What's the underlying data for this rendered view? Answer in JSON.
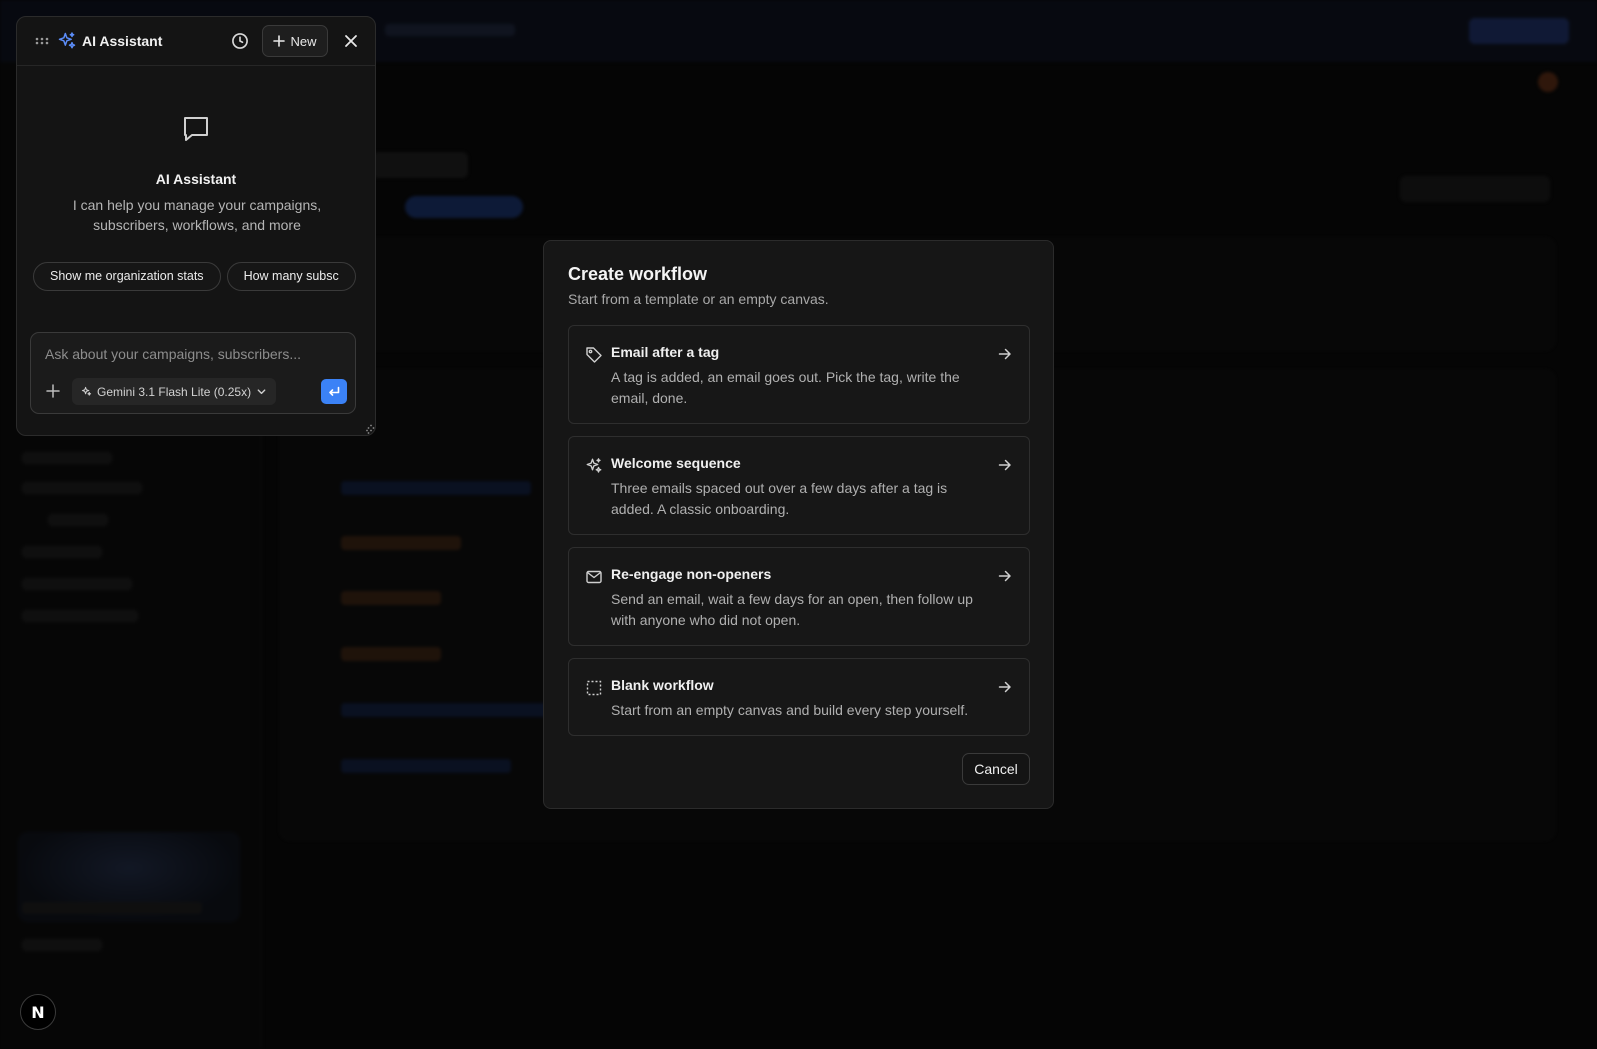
{
  "ai_assistant": {
    "title": "AI Assistant",
    "new_label": "New",
    "empty_title": "AI Assistant",
    "empty_description": "I can help you manage your campaigns, subscribers, workflows, and more",
    "suggestions": [
      "Show me organization stats",
      "How many subsc"
    ],
    "input_placeholder": "Ask about your campaigns, subscribers...",
    "model_label": "Gemini 3.1 Flash Lite (0.25x)",
    "icons": [
      "drag-handle-icon",
      "sparkles-icon",
      "history-clock-icon",
      "plus-icon",
      "close-icon",
      "chat-bubble-icon",
      "chevron-down-icon",
      "enter-icon",
      "resize-handle-icon"
    ]
  },
  "modal": {
    "title": "Create workflow",
    "subtitle": "Start from a template or an empty canvas.",
    "options": [
      {
        "icon": "tag-icon",
        "title": "Email after a tag",
        "description": "A tag is added, an email goes out. Pick the tag, write the email, done."
      },
      {
        "icon": "sparkles-icon",
        "title": "Welcome sequence",
        "description": "Three emails spaced out over a few days after a tag is added. A classic onboarding."
      },
      {
        "icon": "mail-icon",
        "title": "Re-engage non-openers",
        "description": "Send an email, wait a few days for an open, then follow up with anyone who did not open."
      },
      {
        "icon": "dashed-square-icon",
        "title": "Blank workflow",
        "description": "Start from an empty canvas and build every step yourself."
      }
    ],
    "cancel_label": "Cancel"
  },
  "dev_badge": {
    "letter": "N"
  },
  "colors": {
    "accent": "#3b82f6",
    "panel_bg": "#141414",
    "modal_bg": "#161616",
    "border": "#2e2e2e",
    "backdrop": "#050505"
  }
}
